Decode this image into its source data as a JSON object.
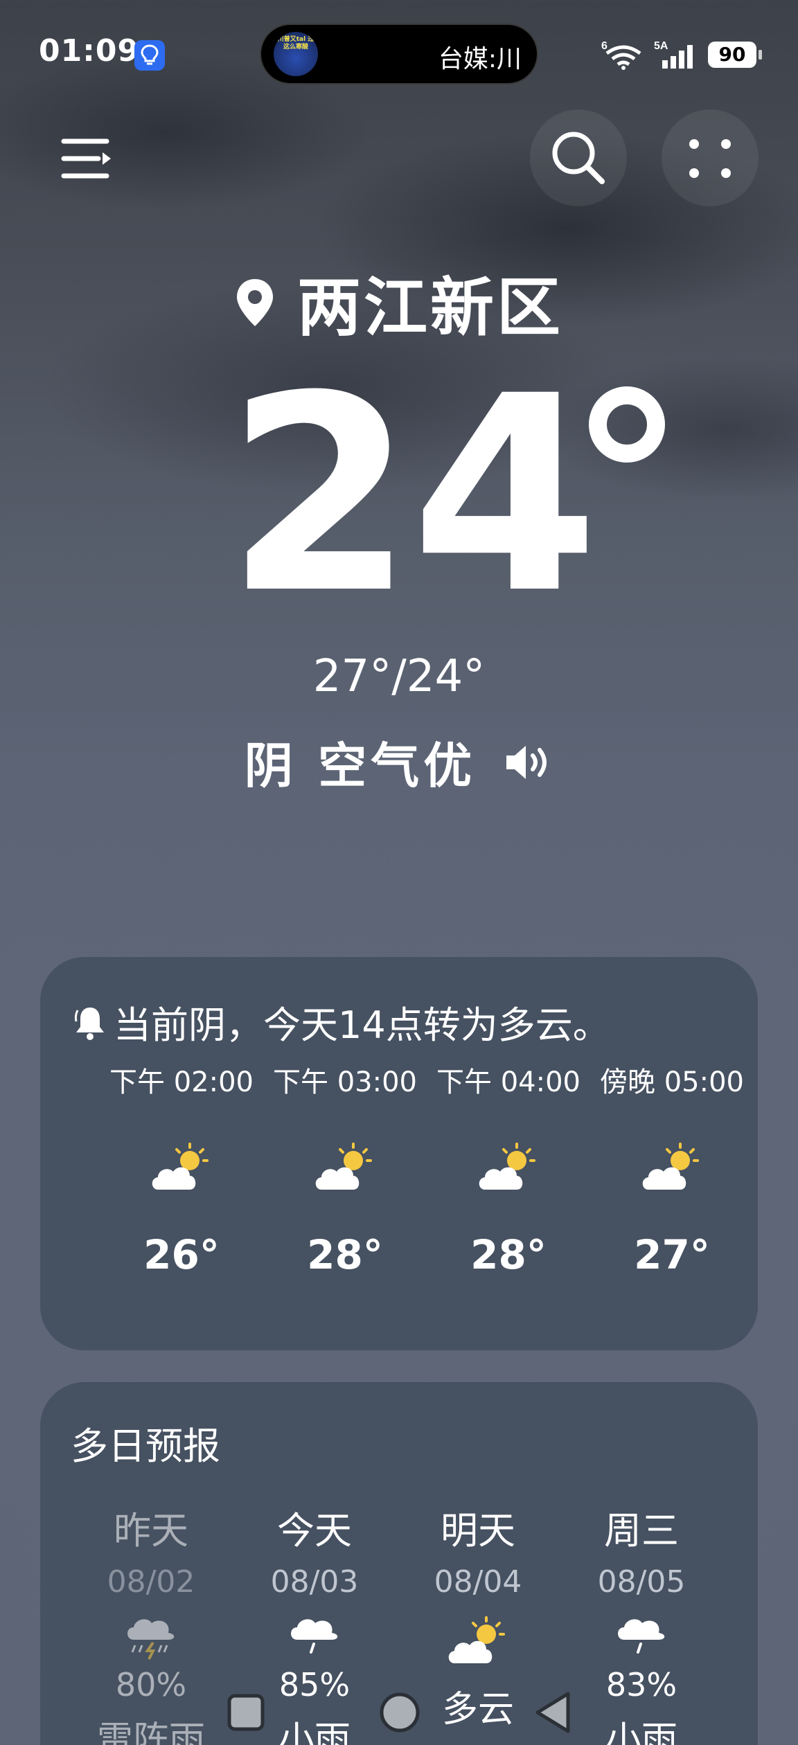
{
  "status_bar": {
    "time": "01:09",
    "island_text": "台媒:川",
    "island_thumb_text": "川普又tal 过这么寒酸",
    "network_label": "5A",
    "wifi_label": "6",
    "battery": "90"
  },
  "header": {
    "menu_icon": "menu-icon",
    "search_icon": "search-icon",
    "more_icon": "more-icon"
  },
  "weather": {
    "location": "两江新区",
    "temperature": "24",
    "hi_lo": "27°/24°",
    "condition": "阴 空气优"
  },
  "alert": {
    "text": "当前阴，今天14点转为多云。",
    "hours": [
      {
        "label": "下午 02:00",
        "temp": "26°",
        "icon": "partly-cloudy-icon"
      },
      {
        "label": "下午 03:00",
        "temp": "28°",
        "icon": "partly-cloudy-icon"
      },
      {
        "label": "下午 04:00",
        "temp": "28°",
        "icon": "partly-cloudy-icon"
      },
      {
        "label": "傍晚 05:00",
        "temp": "27°",
        "icon": "partly-cloudy-icon"
      }
    ]
  },
  "forecast": {
    "title": "多日预报",
    "days": [
      {
        "name": "昨天",
        "date": "08/02",
        "pop": "80%",
        "cond": "雷阵雨",
        "icon": "thunderstorm-icon"
      },
      {
        "name": "今天",
        "date": "08/03",
        "pop": "85%",
        "cond": "小雨",
        "icon": "light-rain-icon"
      },
      {
        "name": "明天",
        "date": "08/04",
        "pop": "",
        "cond": "多云",
        "icon": "partly-cloudy-icon"
      },
      {
        "name": "周三",
        "date": "08/05",
        "pop": "83%",
        "cond": "小雨",
        "icon": "light-rain-icon"
      }
    ]
  },
  "colors": {
    "card": "#465161",
    "sun": "#f5c842",
    "accent_blue": "#2d6cf0"
  }
}
